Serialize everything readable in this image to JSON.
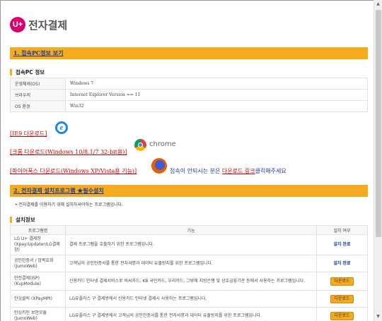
{
  "logo": {
    "mark": "U+",
    "text": "전자결제"
  },
  "section1": {
    "title": "1. 접속PC정보 보기"
  },
  "pc_info": {
    "heading": "접속PC 정보",
    "rows": [
      {
        "key": "운영체제(OS)",
        "value": "Windows 7"
      },
      {
        "key": "브라우저",
        "value": "Internet Explorer Version == 11"
      },
      {
        "key": "OS 환경",
        "value": "Win32"
      }
    ]
  },
  "downloads": {
    "ie": "[IE9 다운로드]",
    "chrome": "[크롬 다운로드(Windows 10/8.1/7 32-bit용)]",
    "chrome_brand": "chrome",
    "firefox": "[파이어폭스 다운로드(Windows XP/Vista용 기능)]"
  },
  "contact": {
    "pre": "접속이 안되시는 분은 ",
    "link": "다운로드 링크",
    "post": "클릭해주세요"
  },
  "section2": {
    "title": "2. 전자결제 설치프로그램 ★필수설치"
  },
  "note": "•  전자결제를 이용하기 위해 설치하셔야하는 프로그램입니다.",
  "install": {
    "heading": "설치정보",
    "columns": [
      "프로그램명",
      "기능",
      "설치 여부"
    ],
    "rows": [
      {
        "name": "LG U+ 결제창 (Xpay/Updater/LG결제창)",
        "desc": "결제 프로그램을 호출하기 위한 프로그램입니다.",
        "status": "설치 완료",
        "kind": "done"
      },
      {
        "name": "공인인증서 / 암복호화 (JumoWeb)",
        "desc": "고객님의 공인인증서를 통한 전자서명과 데이터 유출방지를 위한 프로그램입니다.",
        "status": "설치 완료",
        "kind": "done"
      },
      {
        "name": "안전결제(ISP) (KvpModule)",
        "desc": "신용카드 인터넷 결제서비스로 비씨카드, KB 국민카드, 우리카드, 그밖에 지방은행 및 상호금융기관 등에서 사용하는 프로그램입니다.",
        "status": "다운로드",
        "kind": "btn"
      },
      {
        "name": "안심클릭 (XPayMPI)",
        "desc": "LG유플러스 구 결제방에서 신용카드 인터넷 결제시 사용하는 프로그램입니다.",
        "status": "다운로드",
        "kind": "btn"
      },
      {
        "name": "안심키인 보안모듈 (JumoWeb)",
        "desc": "LG유플러스 구 결제방에서 고객님의 공인인증서를 통한 전자서명과 데이터 유출방지를 위한 프로그램입니다.",
        "status": "다운로드",
        "kind": "btn"
      }
    ]
  }
}
